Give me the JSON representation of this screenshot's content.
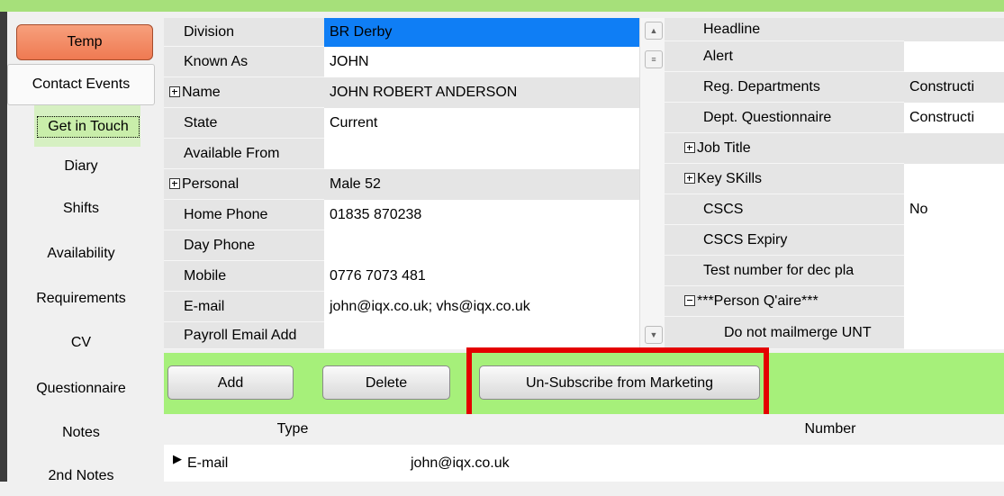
{
  "nav": {
    "temp": "Temp",
    "contact_events": "Contact Events",
    "get_in_touch": "Get in Touch",
    "items": [
      "Diary",
      "Shifts",
      "Availability",
      "Requirements",
      "CV",
      "Questionnaire",
      "Notes",
      "2nd Notes"
    ]
  },
  "left_grid": {
    "rows": [
      {
        "label": "Division",
        "value": "BR Derby"
      },
      {
        "label": "Known As",
        "value": "JOHN"
      },
      {
        "label": "Name",
        "value": "JOHN ROBERT ANDERSON"
      },
      {
        "label": "State",
        "value": "Current"
      },
      {
        "label": "Available From",
        "value": ""
      },
      {
        "label": "Personal",
        "value": "Male 52"
      },
      {
        "label": "Home Phone",
        "value": "01835 870238"
      },
      {
        "label": "Day Phone",
        "value": ""
      },
      {
        "label": "Mobile",
        "value": "0776 7073 481"
      },
      {
        "label": "E-mail",
        "value": "john@iqx.co.uk; vhs@iqx.co.uk"
      },
      {
        "label": "Payroll Email Add",
        "value": ""
      }
    ]
  },
  "right_grid": {
    "rows": [
      {
        "label": "Headline",
        "value": ""
      },
      {
        "label": "Alert",
        "value": ""
      },
      {
        "label": "Reg. Departments",
        "value": "Constructi"
      },
      {
        "label": "Dept. Questionnaire",
        "value": "Constructi"
      },
      {
        "label": "Job Title",
        "value": ""
      },
      {
        "label": "Key SKills",
        "value": ""
      },
      {
        "label": "CSCS",
        "value": "No"
      },
      {
        "label": "CSCS Expiry",
        "value": ""
      },
      {
        "label": "Test number for dec pla",
        "value": ""
      },
      {
        "label": "***Person Q'aire***",
        "value": ""
      },
      {
        "label": "Do not mailmerge UNT",
        "value": ""
      }
    ]
  },
  "buttons": {
    "add": "Add",
    "delete": "Delete",
    "unsubscribe": "Un-Subscribe from Marketing"
  },
  "table": {
    "columns": [
      "Type",
      "Number"
    ],
    "rows": [
      {
        "type": "E-mail",
        "number": "john@iqx.co.uk"
      }
    ]
  },
  "colors": {
    "accent_green": "#a6f07a",
    "highlight_red": "#e40000",
    "selected_blue": "#0f7ef5"
  }
}
